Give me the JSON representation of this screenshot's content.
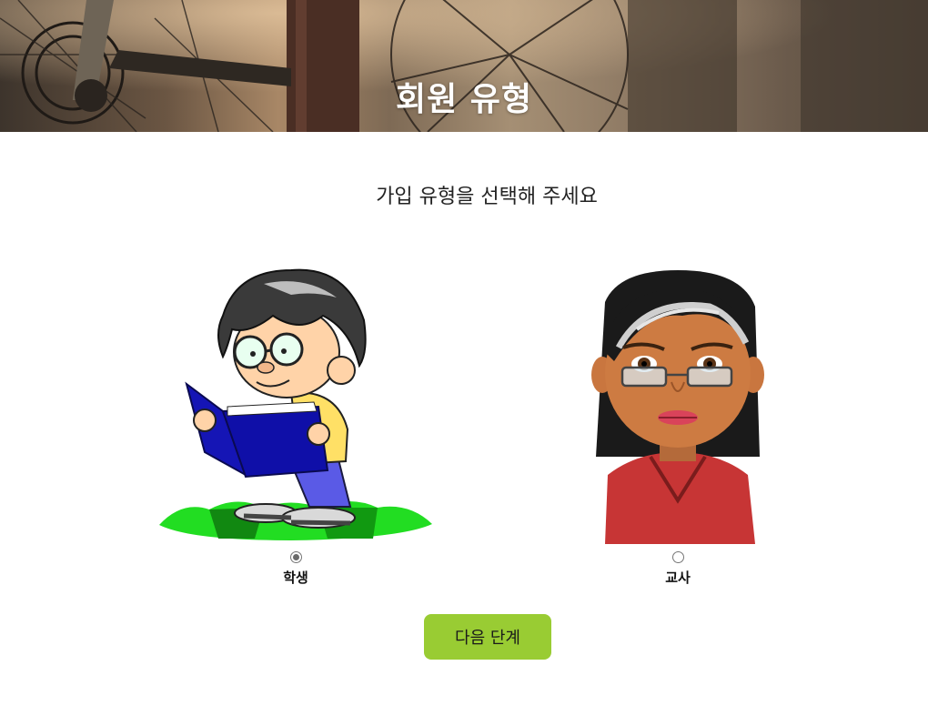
{
  "banner": {
    "title": "회원 유형"
  },
  "prompt": "가입 유형을 선택해 주세요",
  "options": [
    {
      "label": "학생",
      "checked": true,
      "image": "student-reading-book"
    },
    {
      "label": "교사",
      "checked": false,
      "image": "teacher-with-glasses"
    }
  ],
  "next_button": {
    "label": "다음 단계"
  },
  "colors": {
    "accent": "#99cc33",
    "banner_text": "#ffffff"
  }
}
